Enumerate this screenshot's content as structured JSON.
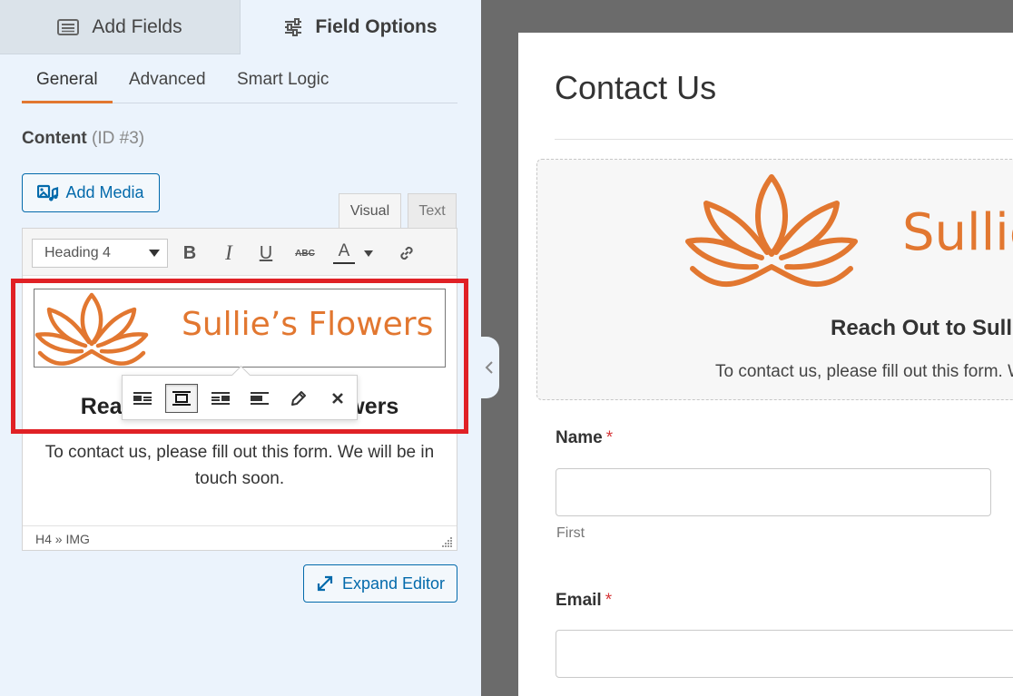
{
  "top_tabs": {
    "add_fields": "Add Fields",
    "field_options": "Field Options"
  },
  "sub_tabs": {
    "general": "General",
    "advanced": "Advanced",
    "smart_logic": "Smart Logic"
  },
  "field": {
    "label": "Content",
    "id": "(ID #3)"
  },
  "buttons": {
    "add_media": "Add Media",
    "expand_editor": "Expand Editor"
  },
  "editor_tabs": {
    "visual": "Visual",
    "text": "Text"
  },
  "toolbar": {
    "format_value": "Heading 4",
    "bold": "B",
    "italic": "I",
    "underline": "U",
    "strikethrough": "ABC",
    "text_color": "A"
  },
  "editor": {
    "logo_text": "Sullie’s Flowers",
    "heading": "Reach Out to Sullie’s Flowers",
    "paragraph": "To contact us, please fill out this form. We will be in touch soon.",
    "path": "H4 » IMG"
  },
  "image_toolbar": {
    "active": "align-center"
  },
  "preview": {
    "title": "Contact Us",
    "logo_text": "Sullie’s Flowers",
    "heading": "Reach Out to Sullie’s Flowers",
    "paragraph": "To contact us, please fill out this form. We will be in touch soon.",
    "name_label": "Name",
    "name_sublabel": "First",
    "email_label": "Email",
    "required_mark": "*"
  },
  "colors": {
    "accent": "#e27730",
    "link": "#036aab",
    "highlight": "#e02126",
    "required": "#d63638"
  }
}
